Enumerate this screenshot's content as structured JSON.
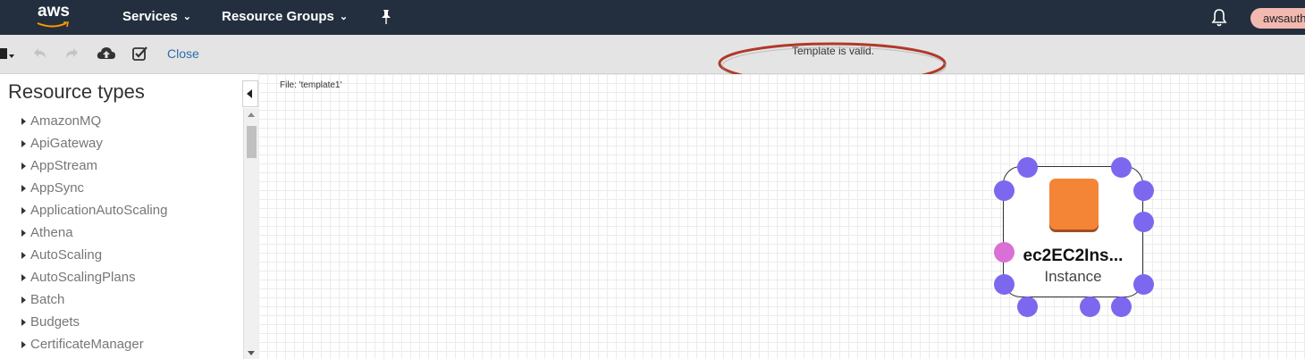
{
  "topnav": {
    "logo": "aws",
    "services_label": "Services",
    "resource_groups_label": "Resource Groups",
    "user_label": "awsauth"
  },
  "toolbar": {
    "close_label": "Close",
    "status_message": "Template is valid."
  },
  "sidebar": {
    "title": "Resource types",
    "items": [
      {
        "label": "AmazonMQ"
      },
      {
        "label": "ApiGateway"
      },
      {
        "label": "AppStream"
      },
      {
        "label": "AppSync"
      },
      {
        "label": "ApplicationAutoScaling"
      },
      {
        "label": "Athena"
      },
      {
        "label": "AutoScaling"
      },
      {
        "label": "AutoScalingPlans"
      },
      {
        "label": "Batch"
      },
      {
        "label": "Budgets"
      },
      {
        "label": "CertificateManager"
      }
    ]
  },
  "canvas": {
    "file_label": "File: 'template1'",
    "node": {
      "name": "ec2EC2Ins...",
      "type": "Instance",
      "icon": "ec2-instance-icon",
      "icon_color": "#f58536"
    }
  },
  "colors": {
    "nav_bg": "#232f3e",
    "toolbar_bg": "#e4e4e4",
    "link": "#2c6ea8",
    "port_dot": "#7b68ee",
    "port_dot_active": "#da70d6",
    "annotation": "#b0392b"
  }
}
